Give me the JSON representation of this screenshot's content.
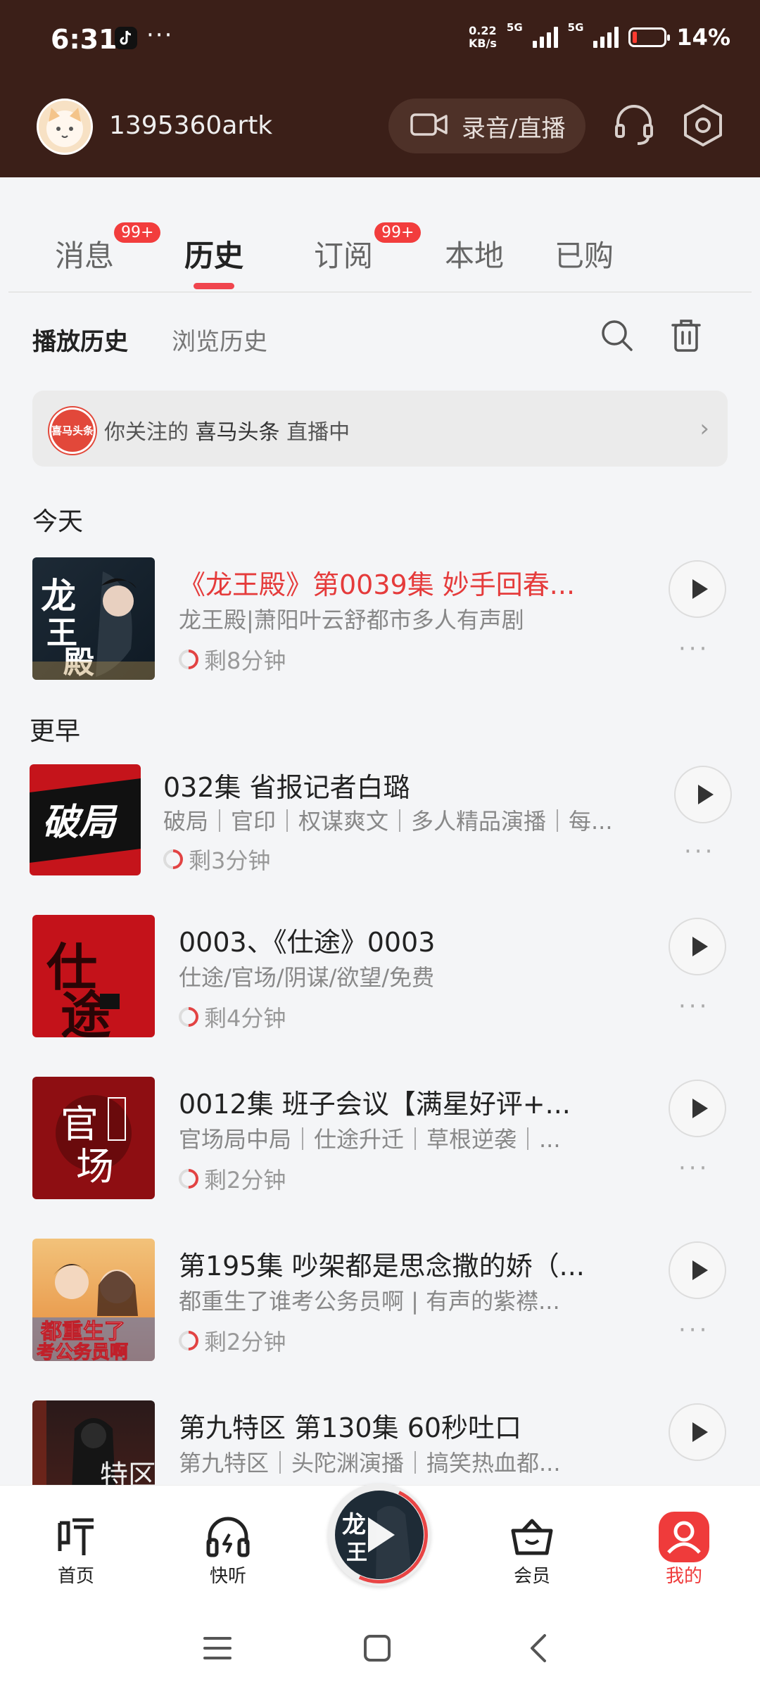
{
  "status_bar": {
    "time": "6:31",
    "dots": "···",
    "net_speed_top": "0.22",
    "net_speed_bottom": "KB/s",
    "sim1": "5G",
    "sim2": "5G",
    "battery": "14%",
    "battery_level": 0.14
  },
  "header": {
    "username": "1395360artk",
    "record_live_label": "录音/直播"
  },
  "tabs": [
    {
      "label": "消息",
      "badge": "99+"
    },
    {
      "label": "历史",
      "active": true
    },
    {
      "label": "订阅",
      "badge": "99+"
    },
    {
      "label": "本地"
    },
    {
      "label": "已购"
    }
  ],
  "subtabs": {
    "play_history": "播放历史",
    "browse_history": "浏览历史"
  },
  "live_banner": {
    "logo_text": "喜马头条",
    "prefix": "你关注的",
    "name": "喜马头条",
    "suffix": "直播中"
  },
  "sections": {
    "today": "今天",
    "earlier": "更早"
  },
  "items": [
    {
      "title": "《龙王殿》第0039集 妙手回春...",
      "subtitle": "龙王殿|萧阳叶云舒都市多人有声剧",
      "remaining": "剩8分钟",
      "cover_text": "龙王殿",
      "highlight": true
    },
    {
      "title": "032集 省报记者白璐",
      "subtitle": "破局｜官印｜权谋爽文｜多人精品演播｜每...",
      "remaining": "剩3分钟",
      "cover_text": "破局"
    },
    {
      "title": "0003、《仕途》0003",
      "subtitle": "仕途/官场/阴谋/欲望/免费",
      "remaining": "剩4分钟",
      "cover_text": "仕途"
    },
    {
      "title": "0012集 班子会议【满星好评+...",
      "subtitle": "官场局中局｜仕途升迁｜草根逆袭｜...",
      "remaining": "剩2分钟",
      "cover_text": "官场"
    },
    {
      "title": "第195集 吵架都是思念撒的娇（...",
      "subtitle": "都重生了谁考公务员啊 | 有声的紫襟...",
      "remaining": "剩2分钟",
      "cover_text": "都重生了考公务员啊"
    },
    {
      "title": "第九特区 第130集 60秒吐口",
      "subtitle": "第九特区｜头陀渊演播｜搞笑热血都...",
      "remaining": "",
      "cover_text": "特区"
    }
  ],
  "bottom_nav": [
    {
      "label": "首页",
      "icon": "ting-icon"
    },
    {
      "label": "快听",
      "icon": "headphones-icon"
    },
    {
      "label": "会员",
      "icon": "vip-basket-icon"
    },
    {
      "label": "我的",
      "icon": "profile-icon",
      "active": true
    }
  ],
  "colors": {
    "header_bg": "#3b1f18",
    "accent_red": "#ef3b3b"
  }
}
